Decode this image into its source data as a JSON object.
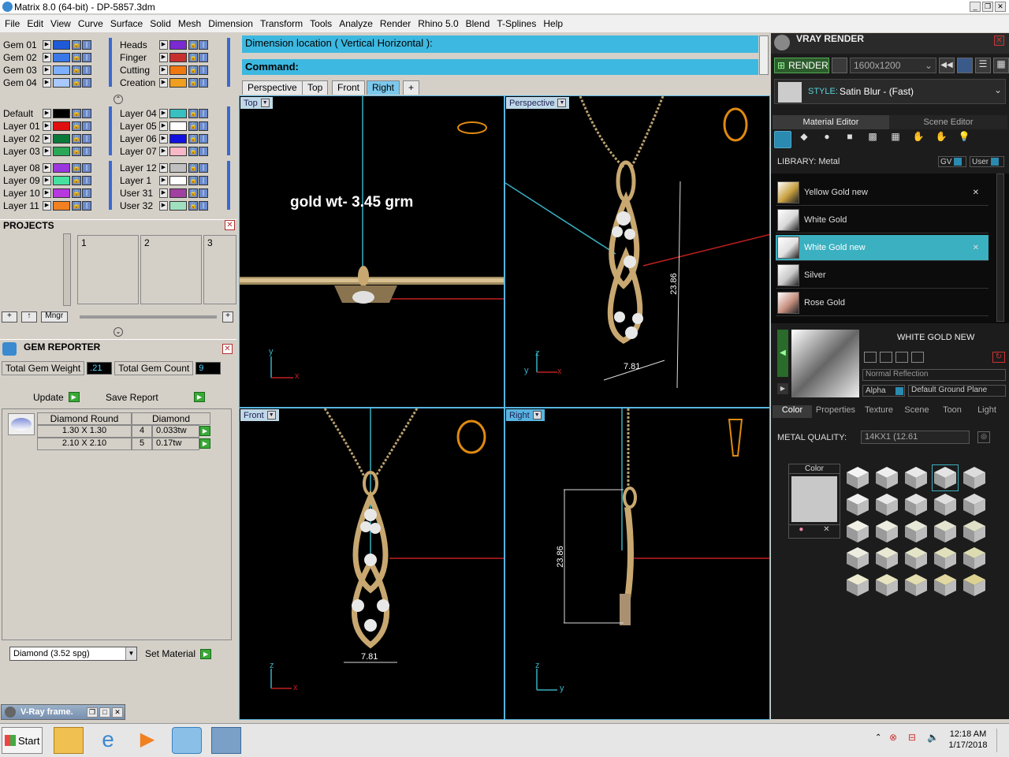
{
  "app": {
    "title": "Matrix 8.0 (64-bit) - DP-5857.3dm",
    "menus": [
      "File",
      "Edit",
      "View",
      "Curve",
      "Surface",
      "Solid",
      "Mesh",
      "Dimension",
      "Transform",
      "Tools",
      "Analyze",
      "Render",
      "Rhino 5.0",
      "Blend",
      "T-Splines",
      "Help"
    ]
  },
  "layers": {
    "col1_top": [
      {
        "name": "Gem 01",
        "color": "#1e5ad8"
      },
      {
        "name": "Gem 02",
        "color": "#3a78e8"
      },
      {
        "name": "Gem 03",
        "color": "#7fb0ff"
      },
      {
        "name": "Gem 04",
        "color": "#a8c8ff"
      }
    ],
    "col2_top": [
      {
        "name": "Heads",
        "color": "#7a2ad0"
      },
      {
        "name": "Finger",
        "color": "#c83030"
      },
      {
        "name": "Cutting",
        "color": "#f07810"
      },
      {
        "name": "Creation",
        "color": "#f0a020"
      }
    ],
    "col1_mid": [
      {
        "name": "Default",
        "color": "#000000"
      },
      {
        "name": "Layer 01",
        "color": "#e01010"
      },
      {
        "name": "Layer 02",
        "color": "#0a7a3a"
      },
      {
        "name": "Layer 03",
        "color": "#2aa858"
      }
    ],
    "col2_mid": [
      {
        "name": "Layer 04",
        "color": "#38c0c0"
      },
      {
        "name": "Layer 05",
        "color": "#ffffff"
      },
      {
        "name": "Layer 06",
        "color": "#1010e0"
      },
      {
        "name": "Layer 07",
        "color": "#f8b8c8"
      }
    ],
    "col1_bot": [
      {
        "name": "Layer 08",
        "color": "#9a38e0"
      },
      {
        "name": "Layer 09",
        "color": "#48e0a0"
      },
      {
        "name": "Layer 10",
        "color": "#b838e0"
      },
      {
        "name": "Layer 11",
        "color": "#f08020"
      }
    ],
    "col2_bot": [
      {
        "name": "Layer 12",
        "color": "#c0c0c0"
      },
      {
        "name": "Layer 1",
        "color": "#ffffff"
      },
      {
        "name": "User 31",
        "color": "#a040a0"
      },
      {
        "name": "User 32",
        "color": "#a0e0c0"
      }
    ]
  },
  "projects": {
    "title": "PROJECTS",
    "slots": [
      "1",
      "2",
      "3"
    ],
    "mngr_label": "Mngr"
  },
  "gem_reporter": {
    "title": "GEM REPORTER",
    "total_weight_label": "Total Gem Weight",
    "total_weight": ".21",
    "total_count_label": "Total Gem Count",
    "total_count": "9",
    "update_label": "Update",
    "save_report_label": "Save Report",
    "table_headers": [
      "Diamond Round",
      "Diamond"
    ],
    "rows": [
      {
        "size": "1.30 X 1.30",
        "count": "4",
        "weight": "0.033tw"
      },
      {
        "size": "2.10 X 2.10",
        "count": "5",
        "weight": "0.17tw"
      }
    ],
    "material_select": "Diamond     (3.52 spg)",
    "set_material_label": "Set Material"
  },
  "vray_frame": {
    "label": "V-Ray frame."
  },
  "command": {
    "prompt1": "Dimension location ( Vertical  Horizontal ):",
    "prompt2": "Command:"
  },
  "viewport_tabs": [
    "Perspective",
    "Top",
    "Front",
    "Right",
    "+"
  ],
  "viewports": {
    "top": {
      "label": "Top",
      "annotation": "gold wt- 3.45 grm",
      "axis_v": "y",
      "axis_h": "x"
    },
    "perspective": {
      "label": "Perspective",
      "dim_height": "23.86",
      "dim_width": "7.81",
      "axis_v": "z",
      "axis_h": "x",
      "axis_o": "y"
    },
    "front": {
      "label": "Front",
      "dim_width": "7.81",
      "axis_v": "z",
      "axis_h": "x"
    },
    "right": {
      "label": "Right",
      "dim_height": "23.86",
      "axis_v": "z",
      "axis_h": "y"
    }
  },
  "vray": {
    "title": "VRAY RENDER",
    "render_label": "RENDER",
    "resolution": "1600x1200",
    "style_label": "STYLE:",
    "style_value": "Satin Blur - (Fast)",
    "tabs": [
      "Material Editor",
      "Scene Editor"
    ],
    "library_label": "LIBRARY: Metal",
    "gv_label": "GV",
    "user_label": "User",
    "materials": [
      {
        "name": "Yellow Gold new",
        "selected": false,
        "color": "#c8a040"
      },
      {
        "name": "White Gold",
        "selected": false,
        "color": "#d8d8d8"
      },
      {
        "name": "White Gold new",
        "selected": true,
        "color": "#e0e0e0"
      },
      {
        "name": "Silver",
        "selected": false,
        "color": "#c8c8c8"
      },
      {
        "name": "Rose Gold",
        "selected": false,
        "color": "#c89080"
      }
    ],
    "preview_title": "WHITE GOLD NEW",
    "reflection": "Normal Reflection",
    "alpha_label": "Alpha",
    "ground_plane": "Default Ground Plane",
    "prop_tabs": [
      "Color",
      "Properties",
      "Texture",
      "Scene",
      "Toon",
      "Light"
    ],
    "metal_quality_label": "METAL QUALITY:",
    "metal_quality_value": "14KX1      (12.61",
    "color_label": "Color"
  },
  "taskbar": {
    "start_label": "Start",
    "time": "12:18 AM",
    "date": "1/17/2018"
  }
}
